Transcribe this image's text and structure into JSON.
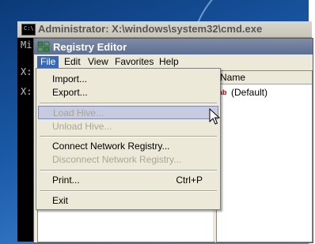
{
  "cmd_window": {
    "title": "Administrator: X:\\windows\\system32\\cmd.exe",
    "icon_text": "C:\\",
    "lines": [
      "Mi",
      "X:",
      "X:"
    ]
  },
  "regedit": {
    "title": "Registry Editor",
    "menu": [
      "File",
      "Edit",
      "View",
      "Favorites",
      "Help"
    ],
    "list_header": "Name",
    "value_name": "(Default)",
    "value_icon_text": "ab"
  },
  "file_menu": {
    "items": [
      {
        "label": "Import...",
        "enabled": true
      },
      {
        "label": "Export...",
        "enabled": true
      },
      {
        "label": "Load Hive...",
        "enabled": false,
        "highlighted": true
      },
      {
        "label": "Unload Hive...",
        "enabled": false
      },
      {
        "label": "Connect Network Registry...",
        "enabled": true
      },
      {
        "label": "Disconnect Network Registry...",
        "enabled": false
      },
      {
        "label": "Print...",
        "enabled": true,
        "shortcut": "Ctrl+P"
      },
      {
        "label": "Exit",
        "enabled": true
      }
    ]
  },
  "colors": {
    "menu_active": "#316ac5",
    "highlight": "#c6cbe0",
    "disabled_text": "#a8a69a"
  }
}
